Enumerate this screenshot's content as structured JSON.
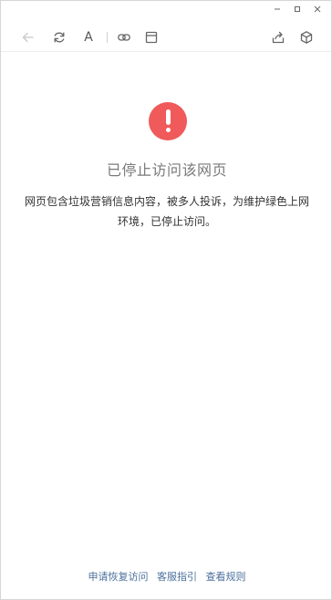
{
  "window": {
    "icons": [
      "minimize-icon",
      "maximize-icon",
      "close-icon"
    ]
  },
  "toolbar": {
    "font_label": "A",
    "icons": [
      "back-arrow-icon",
      "refresh-icon",
      "font-size-icon",
      "link-icon",
      "window-icon",
      "share-icon",
      "cube-icon"
    ]
  },
  "page": {
    "title": "已停止访问该网页",
    "description": "网页包含垃圾营销信息内容，被多人投诉，为维护绿色上网环境，已停止访问。",
    "alert_color": "#f05a5a"
  },
  "footer": {
    "links": [
      "申请恢复访问",
      "客服指引",
      "查看规则"
    ],
    "link_color": "#4b6f9c"
  }
}
